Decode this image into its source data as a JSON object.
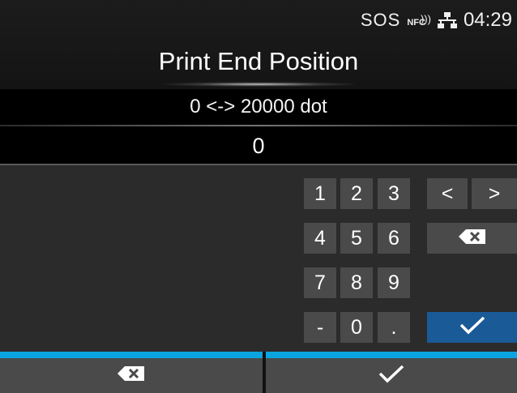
{
  "status": {
    "sos": "SOS",
    "nfc": "NFC",
    "time": "04:29"
  },
  "title": "Print End Position",
  "range_text": "0 <-> 20000 dot",
  "value": "0",
  "keypad": {
    "k1": "1",
    "k2": "2",
    "k3": "3",
    "k4": "4",
    "k5": "5",
    "k6": "6",
    "k7": "7",
    "k8": "8",
    "k9": "9",
    "minus": "-",
    "k0": "0",
    "dot": ".",
    "left": "<",
    "right": ">"
  },
  "icons": {
    "backspace": "backspace-icon",
    "confirm": "check-icon",
    "network": "network-icon",
    "nfc": "nfc-icon"
  },
  "colors": {
    "accent": "#0aa5e0",
    "ok_key": "#1a5a96",
    "key": "#4a4a4a"
  }
}
